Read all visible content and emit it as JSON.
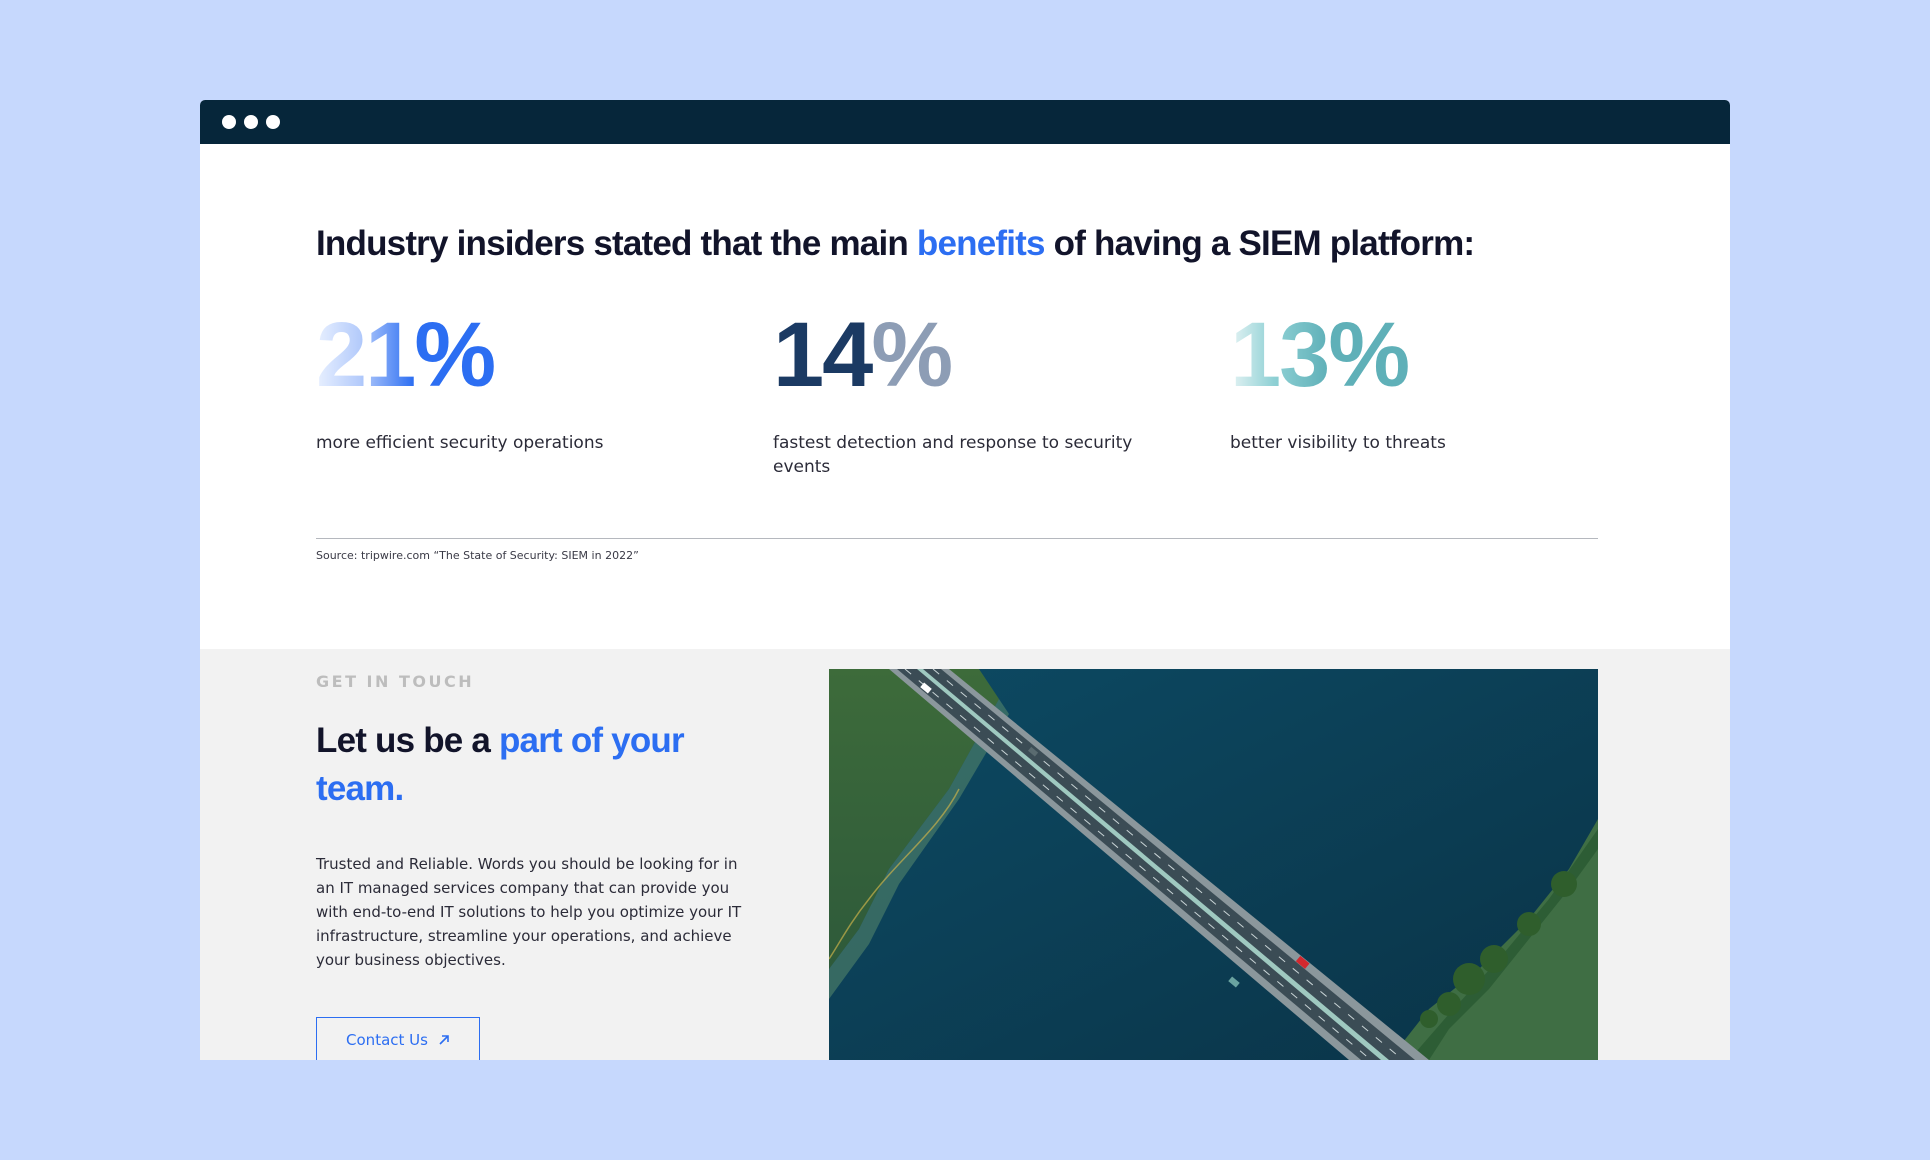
{
  "stats_section": {
    "heading_before": "Industry insiders stated that the main",
    "heading_accent": "benefits",
    "heading_after": "of having a SIEM platform:",
    "stats": [
      {
        "digits": "21",
        "symbol": "%",
        "label": "more efficient security operations"
      },
      {
        "digits": "14",
        "symbol": "%",
        "label": "fastest detection and response to security events"
      },
      {
        "digits": "13",
        "symbol": "%",
        "label": "better visibility to threats"
      }
    ],
    "source": "Source: tripwire.com “The State of Security: SIEM in 2022”"
  },
  "contact_section": {
    "eyebrow": "GET IN TOUCH",
    "title_before": "Let us be a",
    "title_accent": "part of your team.",
    "body": "Trusted and Reliable. Words you should be looking for in an IT managed services company that can provide you with end-to-end IT solutions to help you optimize your IT infrastructure, streamline your operations, and achieve your business objectives.",
    "button_label": "Contact Us",
    "button_icon": "arrow-up-right-icon",
    "image_alt": "aerial view of bridge over river"
  },
  "colors": {
    "page_bg": "#c6d8fd",
    "titlebar": "#06263a",
    "accent_blue": "#2c6ef2",
    "navy": "#1b3a63",
    "teal": "#5fb0b8"
  }
}
